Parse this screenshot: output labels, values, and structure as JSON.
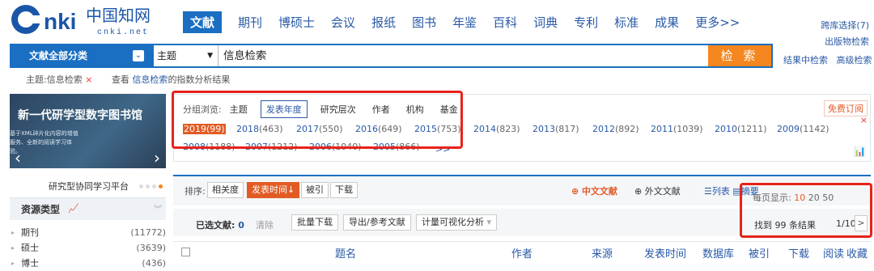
{
  "logo": {
    "cn": "中国知网",
    "en": "cnki.net"
  },
  "nav": [
    {
      "label": "文献",
      "active": true
    },
    {
      "label": "期刊"
    },
    {
      "label": "博硕士"
    },
    {
      "label": "会议"
    },
    {
      "label": "报纸"
    },
    {
      "label": "图书"
    },
    {
      "label": "年鉴"
    },
    {
      "label": "百科"
    },
    {
      "label": "词典"
    },
    {
      "label": "专利"
    },
    {
      "label": "标准"
    },
    {
      "label": "成果"
    },
    {
      "label": "更多>>"
    }
  ],
  "top_right": {
    "cross_db": "跨库选择(7)",
    "publisher_search": "出版物检索"
  },
  "search": {
    "category_label": "文献全部分类",
    "field": "主题",
    "query": "信息检索",
    "button": "检 索",
    "in_results": "结果中检索",
    "advanced": "高级检索"
  },
  "subheader": {
    "tag": "主题:信息检索",
    "remove": "×",
    "view_prefix": "查看",
    "view_link": "信息检索",
    "view_suffix": "的指数分析结果"
  },
  "banner": {
    "title": "新一代研学型数字图书馆",
    "subtitle": "基于XML碎片化内容的增值服务、全新的阅读学习体验。",
    "prev": "‹",
    "next": "›"
  },
  "platform_label": "研究型协同学习平台",
  "resources": {
    "title": "资源类型",
    "items": [
      {
        "label": "期刊",
        "count": "(11772)"
      },
      {
        "label": "硕士",
        "count": "(3639)"
      },
      {
        "label": "博士",
        "count": "(436)"
      }
    ]
  },
  "group_browse": {
    "label": "分组浏览:",
    "tabs": [
      {
        "label": "主题"
      },
      {
        "label": "发表年度",
        "active": true
      },
      {
        "label": "研究层次"
      },
      {
        "label": "作者"
      },
      {
        "label": "机构"
      },
      {
        "label": "基金"
      }
    ],
    "subscribe": "免费订阅",
    "close": "×",
    "more": ">>"
  },
  "years_row1": [
    {
      "year": "2019",
      "count": "(99)",
      "selected": true
    },
    {
      "year": "2018",
      "count": "(463)"
    },
    {
      "year": "2017",
      "count": "(550)"
    },
    {
      "year": "2016",
      "count": "(649)"
    },
    {
      "year": "2015",
      "count": "(753)"
    },
    {
      "year": "2014",
      "count": "(823)"
    },
    {
      "year": "2013",
      "count": "(817)"
    },
    {
      "year": "2012",
      "count": "(892)"
    },
    {
      "year": "2011",
      "count": "(1039)"
    },
    {
      "year": "2010",
      "count": "(1211)"
    },
    {
      "year": "2009",
      "count": "(1142)"
    }
  ],
  "years_row2": [
    {
      "year": "2008",
      "count": "(1188)"
    },
    {
      "year": "2007",
      "count": "(1212)"
    },
    {
      "year": "2006",
      "count": "(1040)"
    },
    {
      "year": "2005",
      "count": "(866)"
    }
  ],
  "sort": {
    "label": "排序:",
    "buttons": [
      {
        "label": "相关度"
      },
      {
        "label": "发表时间↓",
        "active": true
      },
      {
        "label": "被引"
      },
      {
        "label": "下载"
      }
    ],
    "cn_lit": "中文文献",
    "foreign_lit": "外文文献",
    "list": "列表",
    "abstract": "摘要",
    "per_page": "每页显示:",
    "per_page_opts": [
      "10",
      "20",
      "50"
    ]
  },
  "selection": {
    "label": "已选文献:",
    "count": "0",
    "clear": "清除",
    "batch": "批量下载",
    "export": "导出/参考文献",
    "visual": "计量可视化分析",
    "results": "找到 99 条结果",
    "page": "1/10",
    "next": ">"
  },
  "table_headers": [
    "题名",
    "作者",
    "来源",
    "发表时间",
    "数据库",
    "被引",
    "下载",
    "阅读",
    "收藏"
  ],
  "colors": {
    "brand_blue": "#1a6fc2",
    "accent_orange": "#e25b24",
    "highlight_red": "#e8231a"
  }
}
